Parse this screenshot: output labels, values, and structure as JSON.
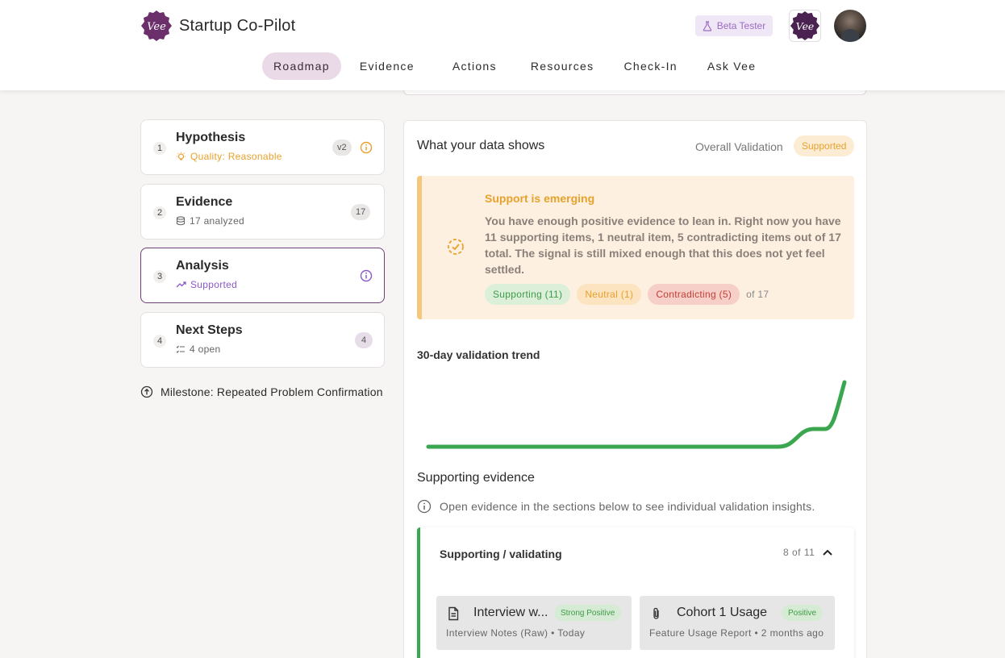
{
  "app": {
    "title": "Startup Co-Pilot",
    "logo_text": "Vee",
    "beta_label": "Beta Tester"
  },
  "nav": {
    "items": [
      {
        "label": "Roadmap",
        "active": true
      },
      {
        "label": "Evidence"
      },
      {
        "label": "Actions"
      },
      {
        "label": "Resources"
      },
      {
        "label": "Check-In"
      },
      {
        "label": "Ask Vee"
      }
    ]
  },
  "steps": [
    {
      "num": "1",
      "title": "Hypothesis",
      "sub": "Quality: Reasonable",
      "badge": "v2"
    },
    {
      "num": "2",
      "title": "Evidence",
      "sub": "17 analyzed",
      "badge": "17"
    },
    {
      "num": "3",
      "title": "Analysis",
      "sub": "Supported"
    },
    {
      "num": "4",
      "title": "Next Steps",
      "sub": "4 open",
      "badge": "4"
    }
  ],
  "milestone": "Milestone: Repeated Problem Confirmation",
  "main": {
    "title": "What your data shows",
    "overall_label": "Overall Validation",
    "overall_value": "Supported",
    "alert": {
      "title": "Support is emerging",
      "body": "You have enough positive evidence to lean in. Right now you have 11 supporting items, 1 neutral item, 5 contradicting items out of 17 total. The signal is still mixed enough that this does not yet feel settled.",
      "chips": {
        "supporting": "Supporting (11)",
        "neutral": "Neutral (1)",
        "contradicting": "Contradicting (5)",
        "total": "of 17"
      }
    },
    "trend_title": "30-day validation trend",
    "supporting_title": "Supporting evidence",
    "supporting_note": "Open evidence in the sections below to see individual validation insights.",
    "accordion": {
      "title": "Supporting / validating",
      "count": "8 of 11",
      "cards": [
        {
          "title": "Interview w...",
          "badge": "Strong Positive",
          "meta": "Interview Notes (Raw) • Today"
        },
        {
          "title": "Cohort 1 Usage",
          "badge": "Positive",
          "meta": "Feature Usage Report • 2 months ago"
        }
      ]
    }
  },
  "colors": {
    "brand": "#6b2f6c",
    "supported": "#e8a12b",
    "positive": "#3aa650",
    "negative": "#c43f36"
  }
}
